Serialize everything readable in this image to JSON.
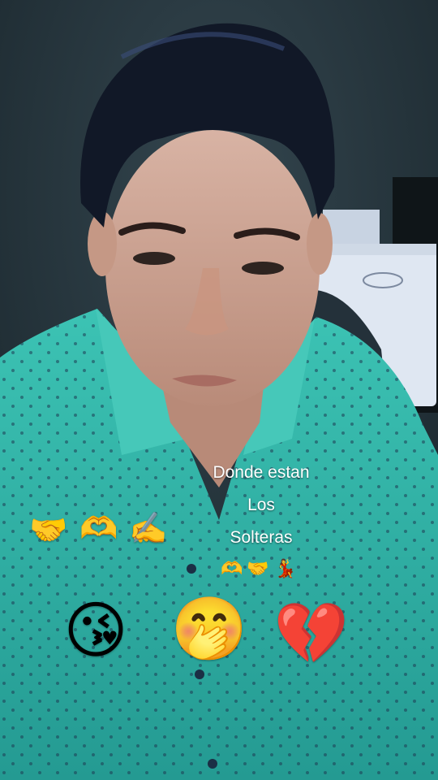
{
  "caption": {
    "line1": "Donde estan",
    "line2": "Los",
    "line3": "Solteras"
  },
  "emoji_row_left": [
    "🤝",
    "🫶",
    "✍️"
  ],
  "emoji_row_small": [
    "🫶",
    "🤝",
    "💃"
  ],
  "emoji_row_big": [
    "😘",
    "🤭",
    "💔"
  ],
  "colors": {
    "shirt": "#33b5a8",
    "wall": "#27363d",
    "hair": "#111827",
    "skin": "#c9a08e",
    "fridge": "#dfe7f2"
  }
}
